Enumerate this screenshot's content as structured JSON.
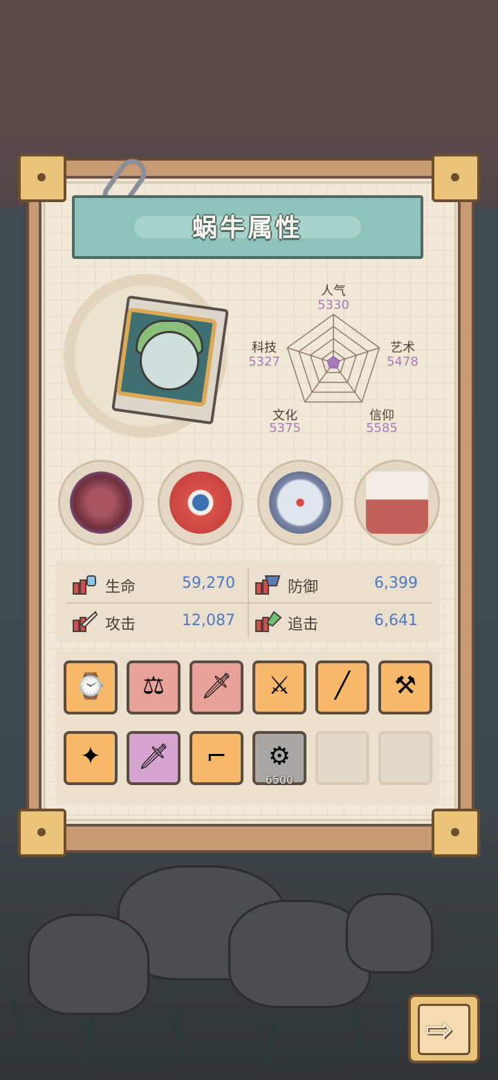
{
  "panel": {
    "title": "蜗牛属性"
  },
  "attributes": [
    {
      "name": "人气",
      "value": "5330"
    },
    {
      "name": "艺术",
      "value": "5478"
    },
    {
      "name": "信仰",
      "value": "5585"
    },
    {
      "name": "文化",
      "value": "5375"
    },
    {
      "name": "科技",
      "value": "5327"
    }
  ],
  "relics": [
    {
      "icon": "tentacle-heart-icon"
    },
    {
      "icon": "shield-shell-icon"
    },
    {
      "icon": "compass-icon"
    },
    {
      "icon": "potion-crate-icon"
    }
  ],
  "stats": {
    "hp": {
      "label": "生命",
      "value": "59,270"
    },
    "defense": {
      "label": "防御",
      "value": "6,399"
    },
    "attack": {
      "label": "攻击",
      "value": "12,087"
    },
    "chase": {
      "label": "追击",
      "value": "6,641"
    }
  },
  "equipment": {
    "row1": [
      {
        "icon": "goggles-icon",
        "rarity": "orange"
      },
      {
        "icon": "amulet-icon",
        "rarity": "red"
      },
      {
        "icon": "dagger-icon",
        "rarity": "red"
      },
      {
        "icon": "crossed-swords-icon",
        "rarity": "orange"
      },
      {
        "icon": "sword-icon",
        "rarity": "orange"
      },
      {
        "icon": "scythe-icon",
        "rarity": "orange"
      }
    ],
    "row2": [
      {
        "icon": "blaster-icon",
        "rarity": "orange"
      },
      {
        "icon": "kris-icon",
        "rarity": "purple"
      },
      {
        "icon": "pistol-icon",
        "rarity": "orange"
      },
      {
        "icon": "locked-gear-icon",
        "rarity": "grey",
        "price": "6500"
      },
      {
        "icon": "empty-slot",
        "rarity": "empty"
      },
      {
        "icon": "empty-slot",
        "rarity": "empty"
      }
    ]
  },
  "colors": {
    "attribute_value": "#a57ab9",
    "stat_value": "#4f78c4",
    "banner": "#8ec3bb"
  },
  "radar": {
    "levels": 4,
    "values": [
      5330,
      5478,
      5585,
      5375,
      5327
    ]
  }
}
